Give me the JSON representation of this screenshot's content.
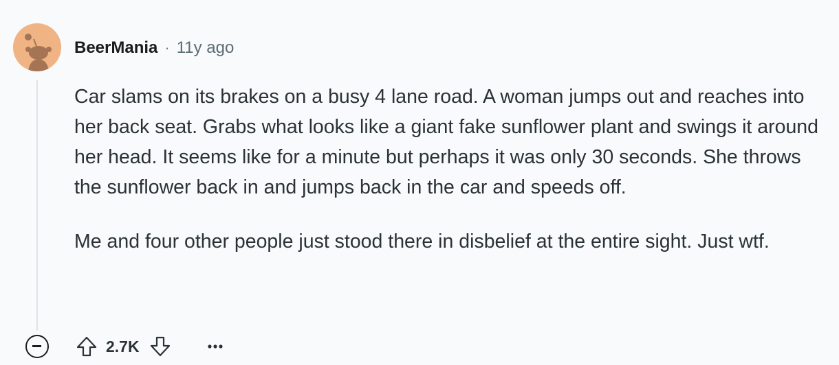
{
  "comment": {
    "author": "BeerMania",
    "separator": "·",
    "timestamp": "11y ago",
    "avatar_icon": "snoo-avatar-icon",
    "paragraphs": [
      "Car slams on its brakes on a busy 4 lane road. A woman jumps out and reaches into her back seat. Grabs what looks like a giant fake sunflower plant and swings it around her head. It seems like for a minute but perhaps it was only 30 seconds. She throws the sunflower back in and jumps back in the car and speeds off.",
      "Me and four other people just stood there in disbelief at the entire sight. Just wtf."
    ],
    "score": "2.7K"
  },
  "icons": {
    "collapse": "collapse-minus-icon",
    "upvote": "upvote-arrow-icon",
    "downvote": "downvote-arrow-icon",
    "more": "more-options-icon"
  },
  "colors": {
    "background": "#f9fafb",
    "avatar": "#f0b484",
    "text": "#2a3236",
    "muted": "#5c6c74"
  }
}
